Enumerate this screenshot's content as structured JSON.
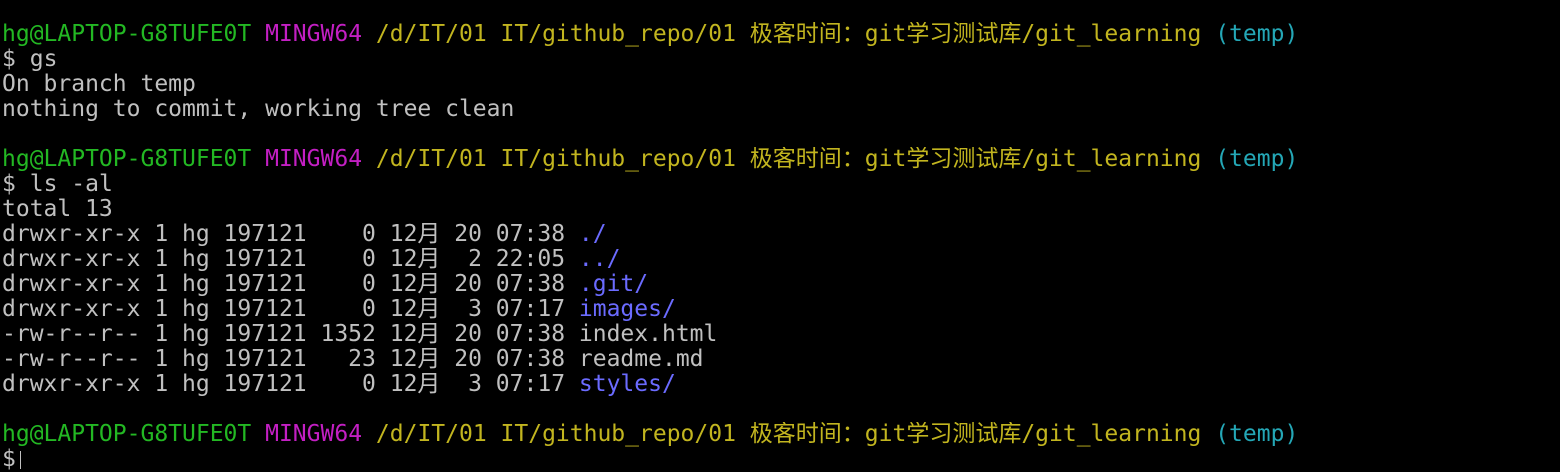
{
  "colors": {
    "background": "#000000",
    "text": "#c0c0c0",
    "user_host": "#23b823",
    "system": "#c31fc3",
    "path": "#c2b51f",
    "branch": "#24a7b6",
    "directory": "#6b6bff"
  },
  "prompt": {
    "user_host": "hg@LAPTOP-G8TUFE0T",
    "system": "MINGW64",
    "path": "/d/IT/01 IT/github_repo/01 极客时间：git学习测试库/git_learning",
    "branch": "(temp)",
    "symbol": "$"
  },
  "commands": [
    {
      "command": "gs",
      "output": [
        "On branch temp",
        "nothing to commit, working tree clean"
      ]
    },
    {
      "command": "ls -al",
      "total": "total 13",
      "entries": [
        {
          "meta": "drwxr-xr-x 1 hg 197121    0 12月 20 07:38 ",
          "name": "./",
          "type": "dir"
        },
        {
          "meta": "drwxr-xr-x 1 hg 197121    0 12月  2 22:05 ",
          "name": "../",
          "type": "dir"
        },
        {
          "meta": "drwxr-xr-x 1 hg 197121    0 12月 20 07:38 ",
          "name": ".git/",
          "type": "dir"
        },
        {
          "meta": "drwxr-xr-x 1 hg 197121    0 12月  3 07:17 ",
          "name": "images/",
          "type": "dir"
        },
        {
          "meta": "-rw-r--r-- 1 hg 197121 1352 12月 20 07:38 ",
          "name": "index.html",
          "type": "file"
        },
        {
          "meta": "-rw-r--r-- 1 hg 197121   23 12月 20 07:38 ",
          "name": "readme.md",
          "type": "file"
        },
        {
          "meta": "drwxr-xr-x 1 hg 197121    0 12月  3 07:17 ",
          "name": "styles/",
          "type": "dir"
        }
      ]
    }
  ]
}
